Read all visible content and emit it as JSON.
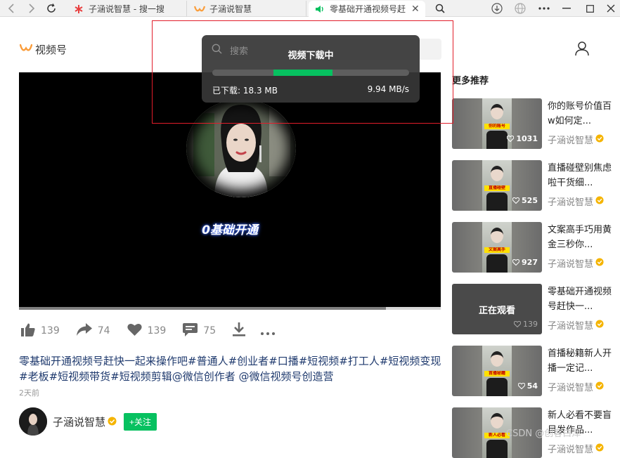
{
  "browser": {
    "tabs": [
      {
        "title": "子涵说智慧 - 搜一搜",
        "state": "inactive"
      },
      {
        "title": "子涵说智慧",
        "state": "inactive"
      },
      {
        "title": "零基础开通视频号赶",
        "state": "active"
      }
    ],
    "icons": [
      "back-icon",
      "forward-icon",
      "reload-icon",
      "search-icon",
      "download-icon",
      "globe-icon",
      "more-icon",
      "minimize-icon",
      "maximize-icon",
      "close-icon"
    ]
  },
  "header": {
    "logo_text": "视频号",
    "search_placeholder": "搜索"
  },
  "player": {
    "caption": "0基础开通",
    "progress_fraction": 0.87
  },
  "download": {
    "title": "视频下载中",
    "downloaded": "已下载: 18.3 MB",
    "speed": "9.94 MB/s",
    "bar_start_fraction": 0.31,
    "bar_end_fraction": 0.61,
    "highlight_color": "#e11d2a"
  },
  "actions": [
    {
      "icon": "thumbs-up-icon",
      "count": "139"
    },
    {
      "icon": "share-icon",
      "count": "74"
    },
    {
      "icon": "heart-icon",
      "count": "139"
    },
    {
      "icon": "comment-icon",
      "count": "75"
    },
    {
      "icon": "download-icon",
      "count": ""
    },
    {
      "icon": "more-icon",
      "count": ""
    }
  ],
  "video": {
    "description": "零基础开通视频号赶快一起来操作吧#普通人#创业者#口播#短视频#打工人#短视频变现#老板#短视频带货#短视频剪辑@微信创作者 @微信视频号创造营",
    "posted": "2天前"
  },
  "author": {
    "name": "子涵说智慧",
    "follow_label": "+关注"
  },
  "recommendations": {
    "title": "更多推荐",
    "items": [
      {
        "title": "你的账号价值百w如何定...",
        "author": "子涵说智慧",
        "likes": "1031",
        "band": "你的账号",
        "watching": false
      },
      {
        "title": "直播碰壁别焦虑啦干货细...",
        "author": "子涵说智慧",
        "likes": "525",
        "band": "直播碰壁",
        "watching": false
      },
      {
        "title": "文案高手巧用黄金三秒你...",
        "author": "子涵说智慧",
        "likes": "927",
        "band": "文案高手",
        "watching": false
      },
      {
        "title": "零基础开通视频号赶快一...",
        "author": "子涵说智慧",
        "likes": "139",
        "band": "",
        "watching": true,
        "watching_label": "正在观看"
      },
      {
        "title": "首播秘籍新人开播一定记...",
        "author": "子涵说智慧",
        "likes": "54",
        "band": "首播秘籍",
        "watching": false
      },
      {
        "title": "新人必看不要盲目发作品...",
        "author": "子涵说智慧",
        "likes": "",
        "band": "新人必看",
        "watching": false
      }
    ]
  },
  "watermark": "CSDN @创客白泽",
  "colors": {
    "accent_green": "#07c160",
    "logo_orange": "#fa9d3b",
    "verified_gold": "#f5b400"
  }
}
